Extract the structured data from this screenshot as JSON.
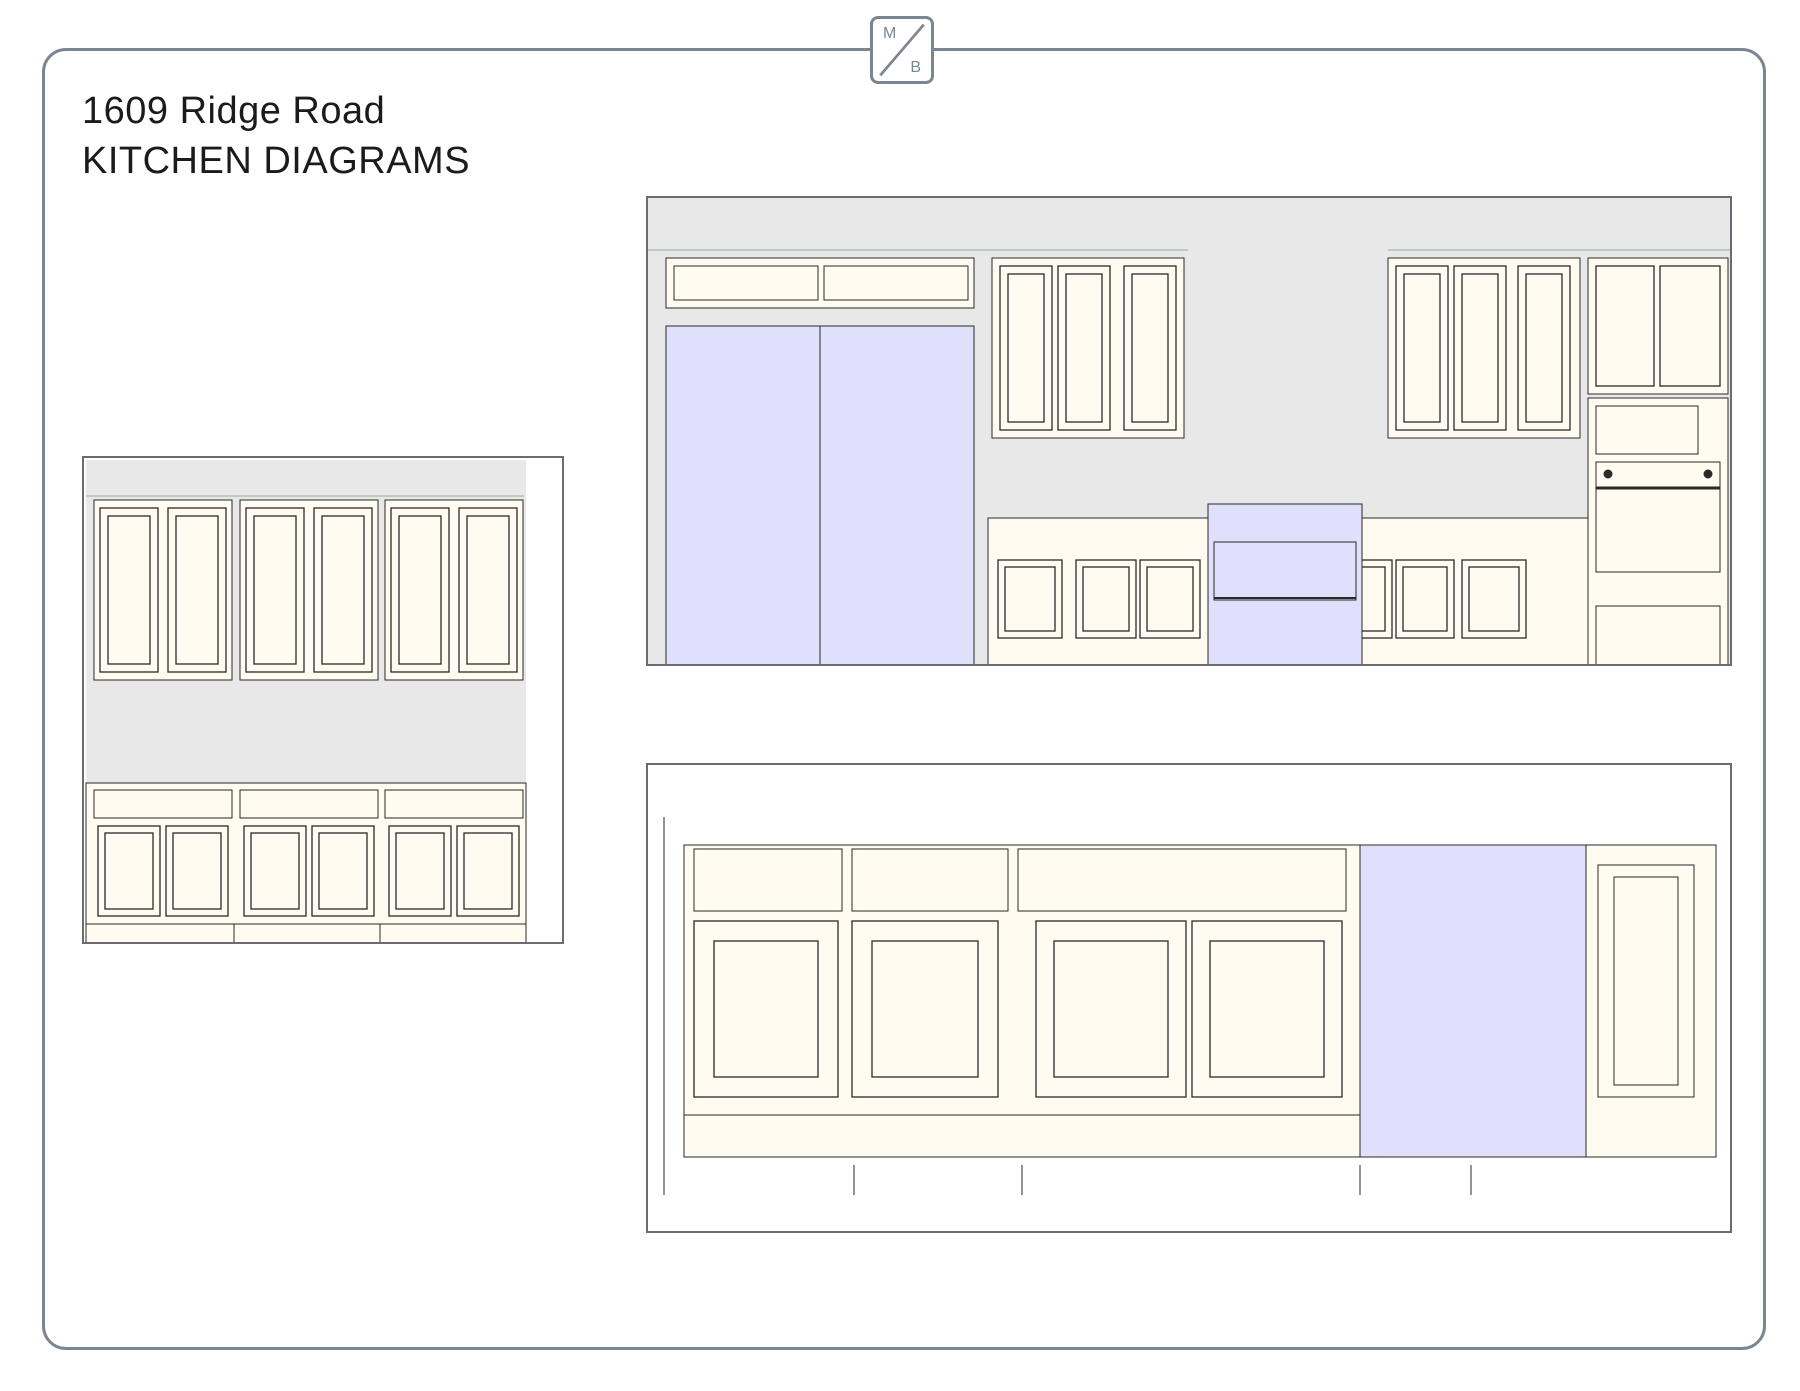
{
  "header": {
    "address": "1609 Ridge Road",
    "subtitle": "KITCHEN DIAGRAMS"
  },
  "logo": {
    "letter_top": "M",
    "letter_bottom": "B"
  },
  "colors": {
    "frame": "#7a8793",
    "cabinet_fill": "#fffbf0",
    "wall_fill": "#e8e8e8",
    "appliance_fill": "#e0e0fb",
    "outline": "#2a2a2a"
  },
  "elevations": [
    {
      "name": "left-wall-elevation",
      "contents": [
        "upper-cabinets",
        "base-cabinets"
      ]
    },
    {
      "name": "main-wall-elevation",
      "contents": [
        "refrigerator",
        "upper-cabinets",
        "range",
        "base-cabinets",
        "wall-oven"
      ]
    },
    {
      "name": "island-elevation",
      "contents": [
        "base-cabinets",
        "dishwasher",
        "end-cabinet"
      ]
    }
  ]
}
